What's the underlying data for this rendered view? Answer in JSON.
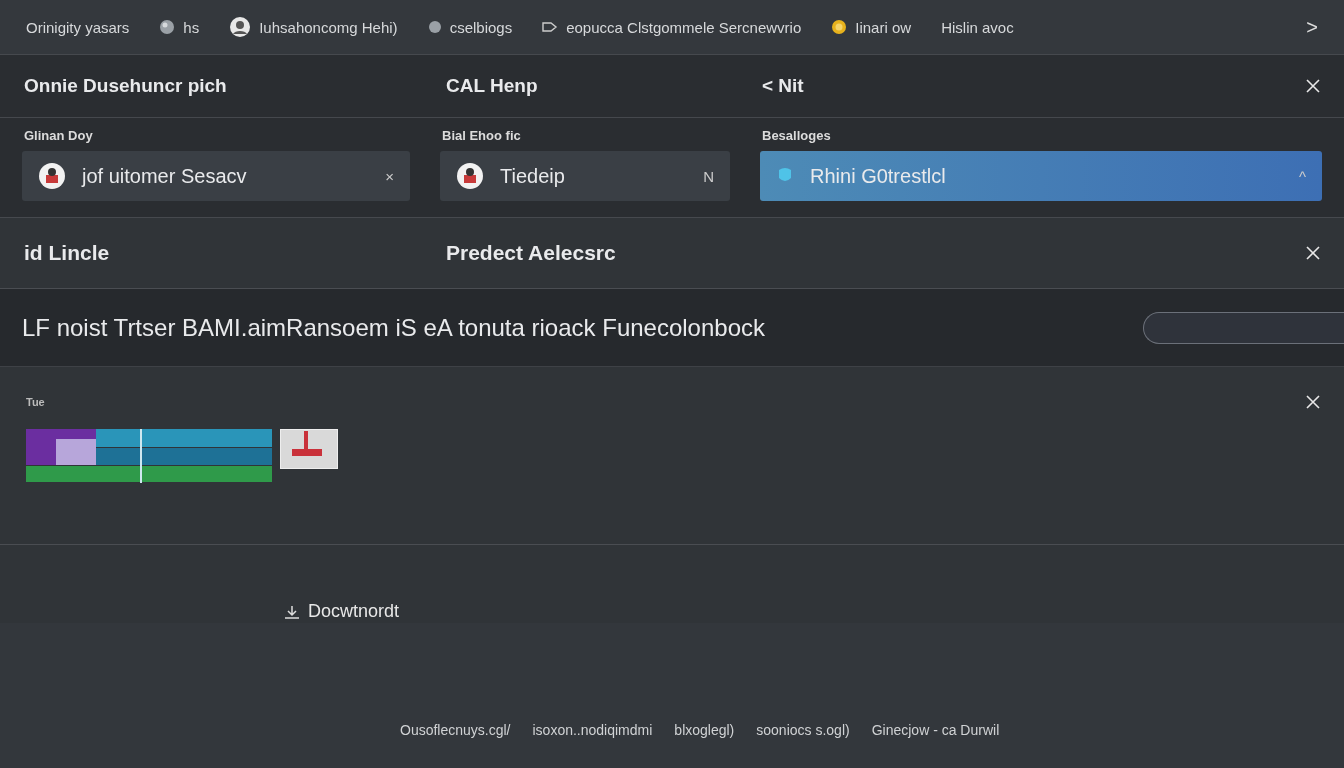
{
  "top_nav": {
    "items": [
      {
        "label": "Orinigity yasars",
        "kind": "plain"
      },
      {
        "label": "hs",
        "kind": "globe"
      },
      {
        "label": "Iuhsahoncomg  Hehi)",
        "kind": "avatar"
      },
      {
        "label": "cselbiogs",
        "kind": "dot"
      },
      {
        "label": "eopucca Clstgommele Sercnewvrio",
        "kind": "tag"
      },
      {
        "label": "Iinari ow",
        "kind": "coin"
      },
      {
        "label": "Hislin avoc",
        "kind": "plain"
      }
    ],
    "next": ">"
  },
  "panel_1": {
    "titles": [
      "Onnie Dusehuncr pich",
      "CAL Henp",
      "< Nit"
    ],
    "fields": [
      {
        "label": "Glinan Doy",
        "value": "jof uitomer Sesacv",
        "trail": "×",
        "selected": false
      },
      {
        "label": "Bial Ehoo fic",
        "value": "Tiedeip",
        "trail": "N",
        "selected": false
      },
      {
        "label": "Besalloges",
        "value": "Rhini G0trestlcl",
        "trail": "^",
        "selected": true
      }
    ]
  },
  "panel_2": {
    "titles": [
      "id Lincle",
      "Predect Aelecsrc"
    ]
  },
  "banner": {
    "text": "LF noist Trtser BAMI.aimRansoem iS eA tonuta rioack Funecolonbock"
  },
  "panel_3": {
    "label": "Tue"
  },
  "download_link": {
    "label": "Docwtnordt"
  },
  "footer_links": [
    "Ousoflecnuys.cgl/",
    "isoxon..nodiqimdmi",
    "blxoglegl)",
    "sooniocs s.ogl)",
    "Ginecjow  -  ca Durwil"
  ]
}
